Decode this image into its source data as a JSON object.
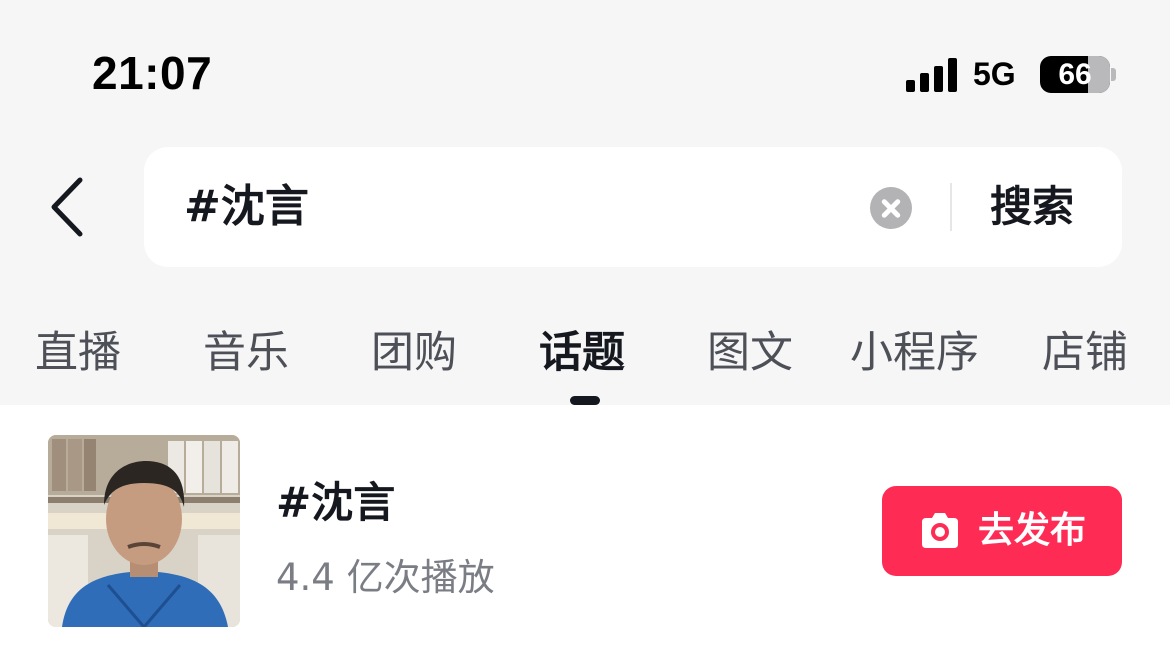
{
  "status_bar": {
    "time": "21:07",
    "network": "5G",
    "battery": "66",
    "signal_bars": 4
  },
  "search": {
    "query": "#沈言",
    "button_label": "搜索"
  },
  "tabs": [
    {
      "label": "直播"
    },
    {
      "label": "音乐"
    },
    {
      "label": "团购"
    },
    {
      "label": "话题",
      "active": true
    },
    {
      "label": "图文"
    },
    {
      "label": "小程序"
    },
    {
      "label": "店铺"
    }
  ],
  "topic": {
    "title": "#沈言",
    "plays": "4.4 亿次播放",
    "publish_label": "去发布",
    "publish_button_color": "#fe2c55"
  }
}
